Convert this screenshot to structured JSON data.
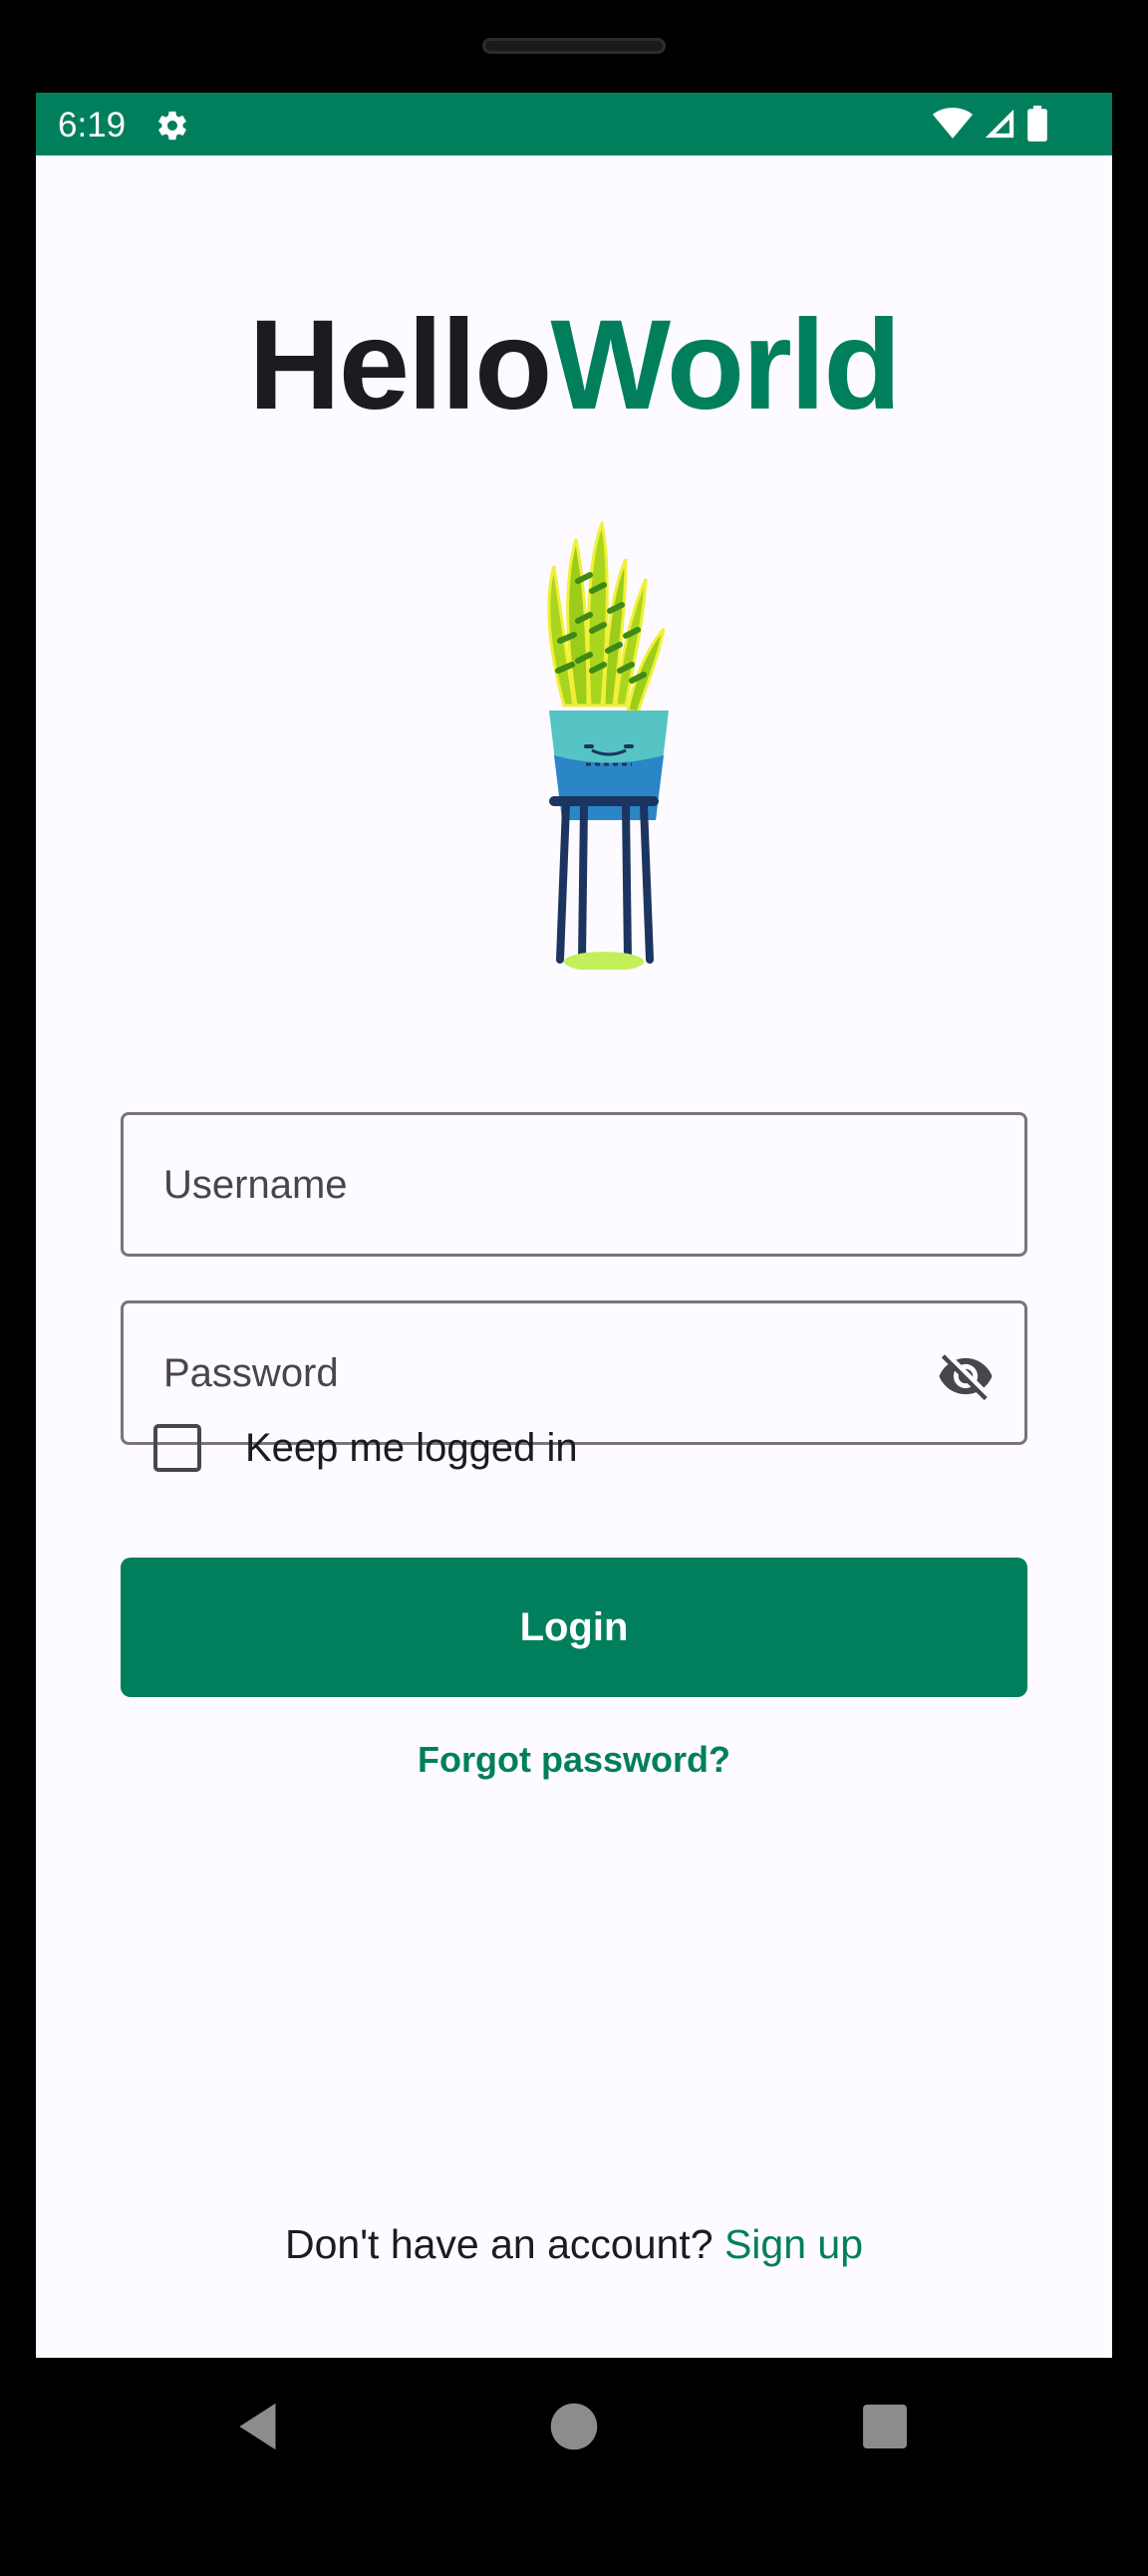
{
  "colors": {
    "brand": "#017f5d",
    "status_bar": "#017f5d",
    "title_dark": "#1d1b1f"
  },
  "status_bar": {
    "time": "6:19",
    "icons": [
      "gear-icon",
      "wifi-icon",
      "signal-icon",
      "battery-icon"
    ]
  },
  "logo": {
    "part1": "Hello",
    "part2": "World"
  },
  "form": {
    "username_placeholder": "Username",
    "password_placeholder": "Password",
    "password_toggle_icon": "eye-off-icon",
    "keep_logged_in_label": "Keep me logged in",
    "keep_logged_in_checked": false,
    "login_label": "Login",
    "forgot_password_label": "Forgot password?"
  },
  "footer": {
    "prompt": "Don't have an account?",
    "signup_label": "Sign up"
  },
  "nav": {
    "icons": [
      "back-icon",
      "home-icon",
      "recents-icon"
    ]
  }
}
